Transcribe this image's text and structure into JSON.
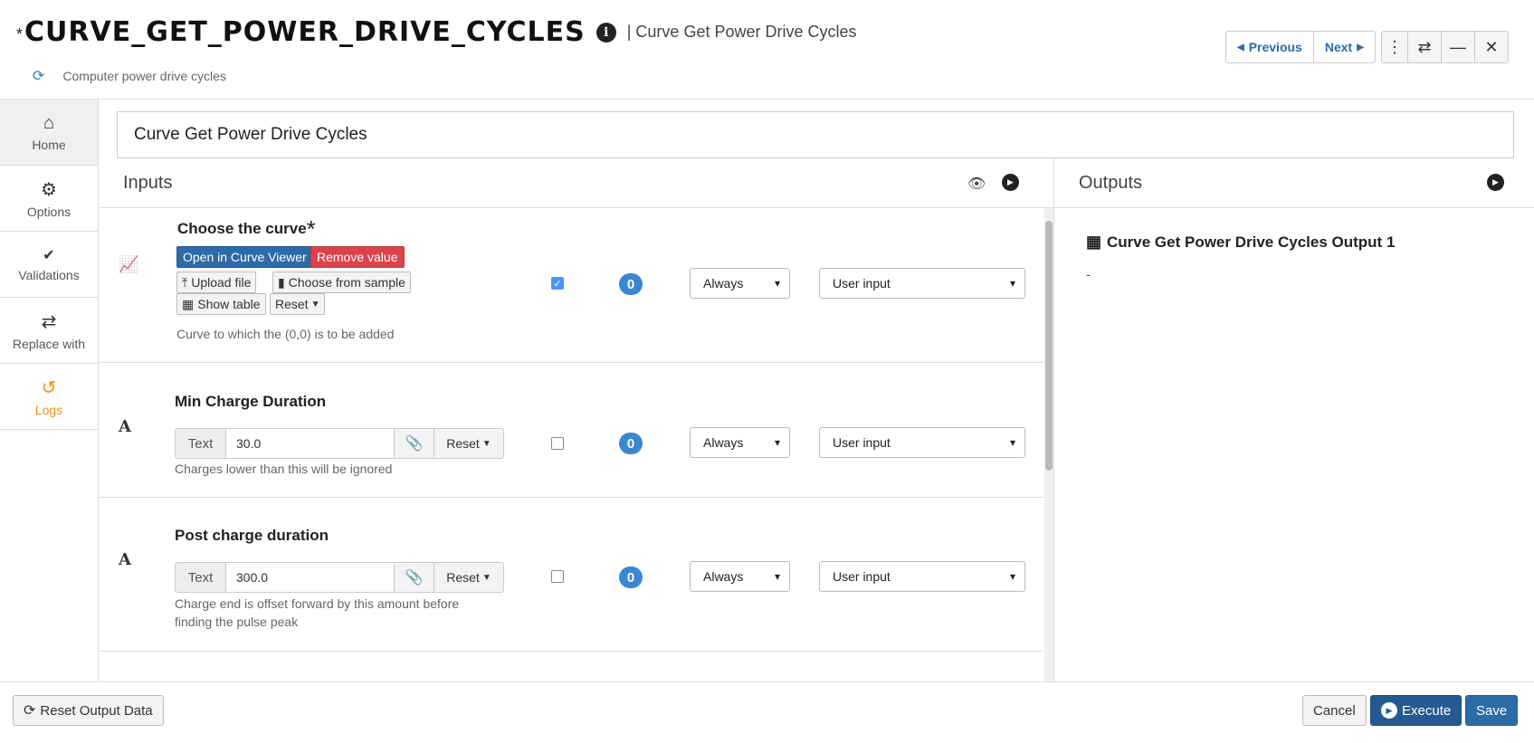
{
  "header": {
    "title_prefix": "*",
    "title": "CURVE_GET_POWER_DRIVE_CYCLES",
    "separator_text": "| Curve Get Power Drive Cycles",
    "subtitle": "Computer power drive cycles",
    "nav": {
      "previous": "Previous",
      "next": "Next"
    },
    "window_buttons": {
      "more": "⋮",
      "swap": "⇄",
      "minimize": "—",
      "close": "✕"
    }
  },
  "sidebar": {
    "items": [
      {
        "label": "Home",
        "icon": "home-icon"
      },
      {
        "label": "Options",
        "icon": "gear-icon"
      },
      {
        "label": "Validations",
        "icon": "check-double-icon"
      },
      {
        "label": "Replace with",
        "icon": "swap-icon"
      },
      {
        "label": "Logs",
        "icon": "history-icon"
      }
    ]
  },
  "name_field": {
    "value": "Curve Get Power Drive Cycles"
  },
  "inputs": {
    "title": "Inputs",
    "rows": [
      {
        "label": "Choose the curve",
        "required_mark": "*",
        "buttons": {
          "open_viewer": "Open in Curve Viewer",
          "remove_value": "Remove value",
          "upload_file": "Upload file",
          "choose_sample": "Choose from sample",
          "show_table": "Show table",
          "reset": "Reset"
        },
        "help": "Curve to which the (0,0) is to be added",
        "checked": true,
        "badge": "0",
        "condition": "Always",
        "source": "User input"
      },
      {
        "label": "Min Charge Duration",
        "addon": "Text",
        "value": "30.0",
        "reset": "Reset",
        "help": "Charges lower than this will be ignored",
        "checked": false,
        "badge": "0",
        "condition": "Always",
        "source": "User input"
      },
      {
        "label": "Post charge duration",
        "addon": "Text",
        "value": "300.0",
        "reset": "Reset",
        "help": "Charge end is offset forward by this amount before finding the pulse peak",
        "checked": false,
        "badge": "0",
        "condition": "Always",
        "source": "User input"
      }
    ]
  },
  "outputs": {
    "title": "Outputs",
    "items": [
      {
        "label": "Curve Get Power Drive Cycles Output 1",
        "value": "-"
      }
    ]
  },
  "footer": {
    "reset_output": "Reset Output Data",
    "cancel": "Cancel",
    "execute": "Execute",
    "save": "Save"
  },
  "colors": {
    "primary": "#2c6aa8",
    "danger": "#d9434a",
    "badge": "#3b87d1",
    "logs_accent": "#f0900f"
  }
}
